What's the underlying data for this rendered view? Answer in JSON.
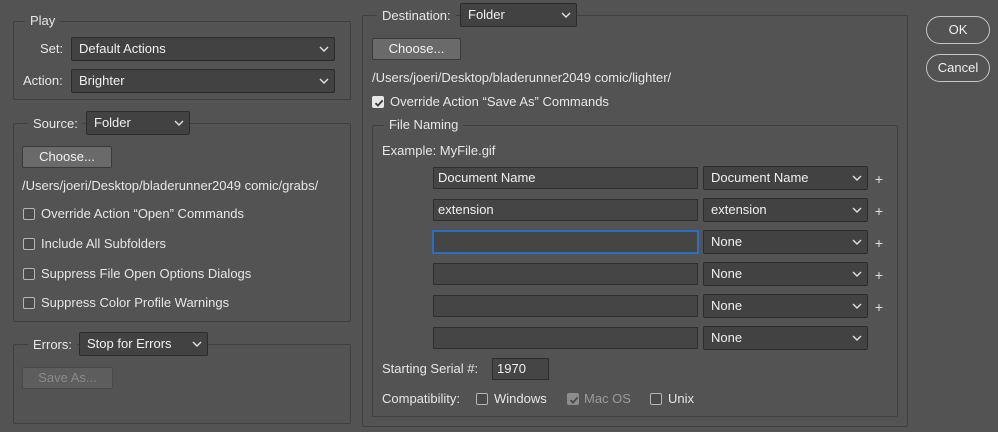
{
  "play": {
    "legend": "Play",
    "set_label": "Set:",
    "set_value": "Default Actions",
    "action_label": "Action:",
    "action_value": "Brighter"
  },
  "source": {
    "label": "Source:",
    "value": "Folder",
    "choose_label": "Choose...",
    "path": "/Users/joeri/Desktop/bladerunner2049 comic/grabs/",
    "options": [
      {
        "label": "Override Action “Open” Commands",
        "checked": false
      },
      {
        "label": "Include All Subfolders",
        "checked": false
      },
      {
        "label": "Suppress File Open Options Dialogs",
        "checked": false
      },
      {
        "label": "Suppress Color Profile Warnings",
        "checked": false
      }
    ]
  },
  "errors": {
    "label": "Errors:",
    "value": "Stop for Errors",
    "save_as_label": "Save As..."
  },
  "destination": {
    "label": "Destination:",
    "value": "Folder",
    "choose_label": "Choose...",
    "path": "/Users/joeri/Desktop/bladerunner2049 comic/lighter/",
    "override_label": "Override Action “Save As” Commands",
    "override_checked": true
  },
  "file_naming": {
    "legend": "File Naming",
    "example": "Example: MyFile.gif",
    "rows": [
      {
        "text": "Document Name",
        "select": "Document Name",
        "plus": "+"
      },
      {
        "text": "extension",
        "select": "extension",
        "plus": "+"
      },
      {
        "text": "",
        "select": "None",
        "plus": "+"
      },
      {
        "text": "",
        "select": "None",
        "plus": "+"
      },
      {
        "text": "",
        "select": "None",
        "plus": "+"
      },
      {
        "text": "",
        "select": "None",
        "plus": ""
      }
    ],
    "serial_label": "Starting Serial #:",
    "serial_value": "1970",
    "compat_label": "Compatibility:",
    "compat": [
      {
        "label": "Windows",
        "checked": false
      },
      {
        "label": "Mac OS",
        "checked": true,
        "disabled": true
      },
      {
        "label": "Unix",
        "checked": false
      }
    ]
  },
  "dialog": {
    "ok_label": "OK",
    "cancel_label": "Cancel"
  }
}
